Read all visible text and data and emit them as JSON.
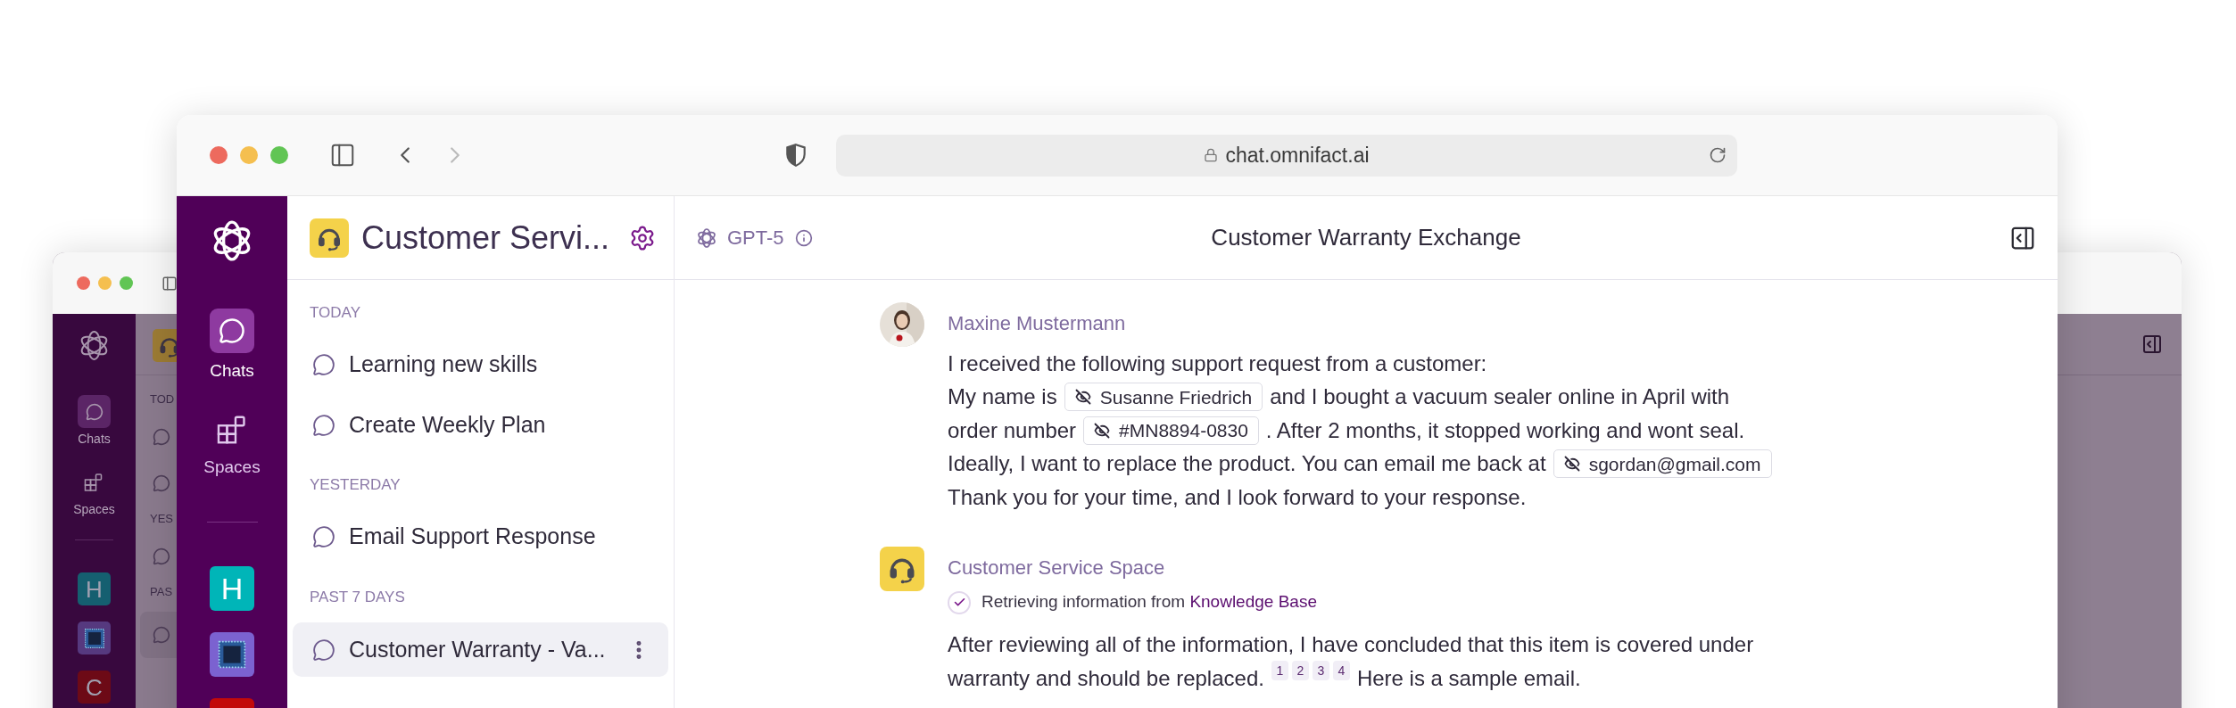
{
  "back_window": {
    "rail": {
      "nav": [
        {
          "label": "Chats",
          "kind": "chats",
          "selected": true
        },
        {
          "label": "Spaces",
          "kind": "spaces",
          "selected": false
        }
      ],
      "spaces": [
        {
          "kind": "letter",
          "letter": "H",
          "color": "#155f70"
        },
        {
          "kind": "chip",
          "color": "#56397f"
        },
        {
          "kind": "letter",
          "letter": "C",
          "color": "#6d0a16"
        }
      ]
    },
    "sidebar": {
      "sections": [
        {
          "label": "TOD",
          "chats": [
            {
              "selected": false
            },
            {
              "selected": false
            }
          ]
        },
        {
          "label": "YES",
          "chats": [
            {
              "selected": false
            }
          ]
        },
        {
          "label": "PAS",
          "chats": [
            {
              "selected": true
            }
          ]
        }
      ]
    }
  },
  "browser": {
    "url": "chat.omnifact.ai",
    "forward_disabled": true
  },
  "rail": {
    "nav": [
      {
        "label": "Chats",
        "kind": "chats",
        "selected": true
      },
      {
        "label": "Spaces",
        "kind": "spaces",
        "selected": false
      }
    ],
    "spaces": [
      {
        "kind": "letter",
        "letter": "H",
        "color": "#00b5b8"
      },
      {
        "kind": "chip",
        "color": "#7b62d0"
      },
      {
        "kind": "blank",
        "color": "#c20a0a"
      }
    ]
  },
  "sidebar": {
    "title": "Customer Servi...",
    "sections": [
      {
        "label": "TODAY",
        "chats": [
          {
            "title": "Learning new skills",
            "selected": false
          },
          {
            "title": "Create Weekly Plan",
            "selected": false
          }
        ]
      },
      {
        "label": "YESTERDAY",
        "chats": [
          {
            "title": "Email Support Response",
            "selected": false
          }
        ]
      },
      {
        "label": "PAST 7 DAYS",
        "chats": [
          {
            "title": "Customer Warranty - Va...",
            "selected": true
          }
        ]
      }
    ]
  },
  "chat": {
    "model": "GPT-5",
    "title": "Customer Warranty Exchange",
    "messages": [
      {
        "kind": "user",
        "author": "Maxine Mustermann",
        "lines": [
          [
            {
              "kind": "text",
              "text": "I received the following support request from a customer:"
            }
          ],
          [
            {
              "kind": "text",
              "text": "My name is"
            },
            {
              "kind": "redacted",
              "text": "Susanne Friedrich"
            },
            {
              "kind": "text",
              "text": "and I bought a vacuum sealer online in April with"
            }
          ],
          [
            {
              "kind": "text",
              "text": "order number"
            },
            {
              "kind": "redacted",
              "text": "#MN8894-0830"
            },
            {
              "kind": "text",
              "text": ". After 2 months, it stopped working and wont seal."
            }
          ],
          [
            {
              "kind": "text",
              "text": "Ideally, I want to replace the product. You can email me back at"
            },
            {
              "kind": "redacted",
              "text": "sgordan@gmail.com"
            }
          ],
          [
            {
              "kind": "text",
              "text": "Thank you for your time, and I look forward to your response."
            }
          ]
        ]
      },
      {
        "kind": "assistant",
        "author": "Customer Service Space",
        "status": {
          "text": "Retrieving information from",
          "source": "Knowledge Base",
          "done": true
        },
        "lines": [
          [
            {
              "kind": "text",
              "text": "After reviewing all of the information, I have concluded that this item is covered under"
            }
          ],
          [
            {
              "kind": "text",
              "text": "warranty and should be replaced."
            },
            {
              "kind": "citations",
              "items": [
                "1",
                "2",
                "3",
                "4"
              ]
            },
            {
              "kind": "text",
              "text": "Here is a sample email."
            }
          ]
        ]
      }
    ]
  }
}
